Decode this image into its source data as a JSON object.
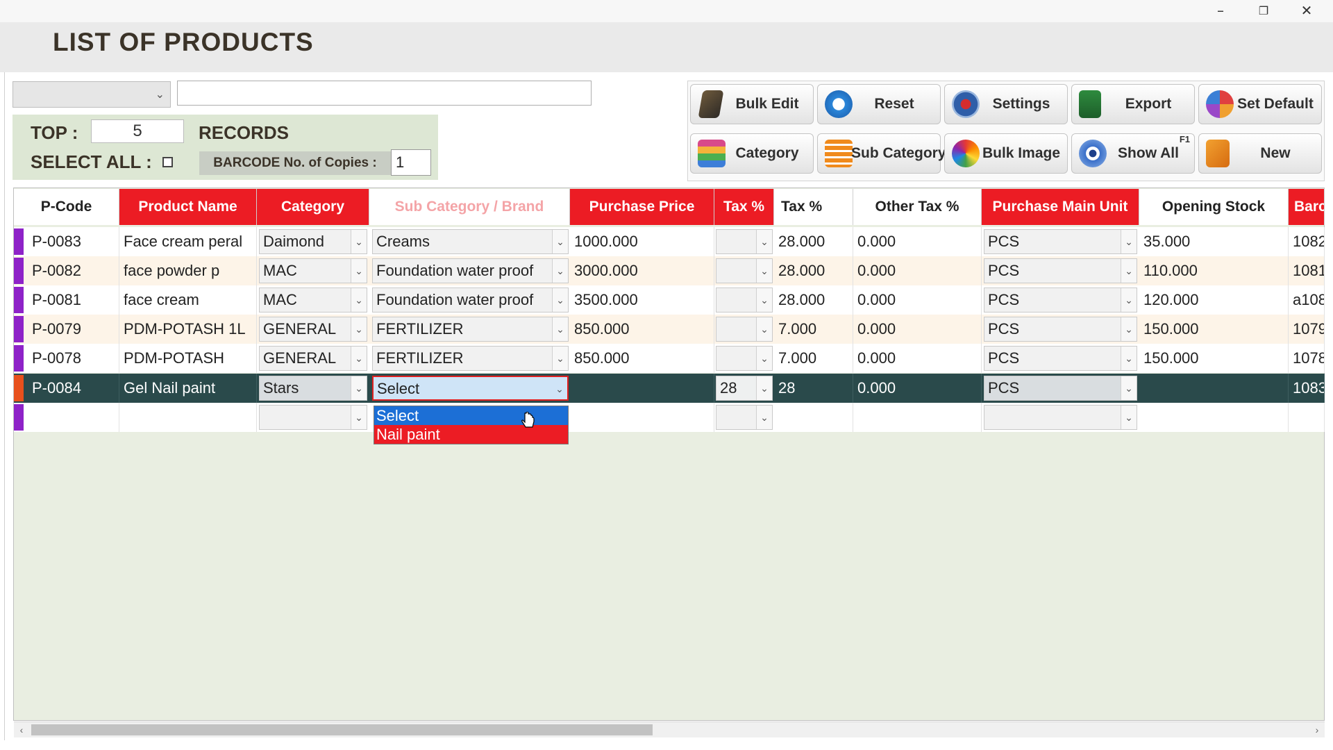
{
  "window": {
    "minimize_icon": "minimize-icon",
    "restore_icon": "restore-icon",
    "close_icon": "close-icon"
  },
  "page": {
    "title": "LIST OF PRODUCTS"
  },
  "filters": {
    "field_select_value": "",
    "search_value": "",
    "top_label": "TOP :",
    "top_value": "5",
    "records_label": "RECORDS",
    "select_all_label": "SELECT ALL :",
    "select_all_checked": false,
    "barcode_copies_label": "BARCODE No. of Copies :",
    "barcode_copies_value": "1"
  },
  "toolbar": {
    "buttons": [
      {
        "label": "Bulk Edit",
        "icon": "bulk-edit-icon"
      },
      {
        "label": "Reset",
        "icon": "reset-icon"
      },
      {
        "label": "Settings",
        "icon": "settings-icon"
      },
      {
        "label": "Export",
        "icon": "export-icon"
      },
      {
        "label": "Set Default",
        "icon": "set-default-icon"
      },
      {
        "label": "Category",
        "icon": "category-icon"
      },
      {
        "label": "Sub Category",
        "icon": "sub-category-icon"
      },
      {
        "label": "Bulk Image",
        "icon": "bulk-image-icon"
      },
      {
        "label": "Show All",
        "icon": "show-all-icon",
        "shortcut": "F1"
      },
      {
        "label": "New",
        "icon": "new-icon"
      }
    ]
  },
  "table": {
    "columns": [
      "P-Code",
      "Product Name",
      "Category",
      "Sub Category / Brand",
      "Purchase Price",
      "Tax %",
      "Tax %",
      "Other Tax %",
      "Purchase Main Unit",
      "Opening Stock",
      "Barc"
    ],
    "rows": [
      {
        "code": "P-0083",
        "name": "Face cream peral",
        "category": "Daimond",
        "sub_category": "Creams",
        "purchase_price": "1000.000",
        "tax_select": "",
        "tax": "28.000",
        "other_tax": "0.000",
        "unit": "PCS",
        "opening_stock": "35.000",
        "barcode": "1082"
      },
      {
        "code": "P-0082",
        "name": "face powder p",
        "category": "MAC",
        "sub_category": "Foundation water proof",
        "purchase_price": "3000.000",
        "tax_select": "",
        "tax": "28.000",
        "other_tax": "0.000",
        "unit": "PCS",
        "opening_stock": "110.000",
        "barcode": "1081"
      },
      {
        "code": "P-0081",
        "name": "face cream",
        "category": "MAC",
        "sub_category": "Foundation water proof",
        "purchase_price": "3500.000",
        "tax_select": "",
        "tax": "28.000",
        "other_tax": "0.000",
        "unit": "PCS",
        "opening_stock": "120.000",
        "barcode": "a108"
      },
      {
        "code": "P-0079",
        "name": "PDM-POTASH 1L",
        "category": "GENERAL",
        "sub_category": "FERTILIZER",
        "purchase_price": "850.000",
        "tax_select": "",
        "tax": "7.000",
        "other_tax": "0.000",
        "unit": "PCS",
        "opening_stock": "150.000",
        "barcode": "1079"
      },
      {
        "code": "P-0078",
        "name": "PDM-POTASH",
        "category": "GENERAL",
        "sub_category": "FERTILIZER",
        "purchase_price": "850.000",
        "tax_select": "",
        "tax": "7.000",
        "other_tax": "0.000",
        "unit": "PCS",
        "opening_stock": "150.000",
        "barcode": "1078"
      },
      {
        "code": "P-0084",
        "name": "Gel Nail paint",
        "category": "Stars",
        "sub_category": "Select",
        "purchase_price": "",
        "tax_select": "28",
        "tax": "28",
        "other_tax": "0.000",
        "unit": "PCS",
        "opening_stock": "",
        "barcode": "1083"
      },
      {
        "code": "",
        "name": "",
        "category": "",
        "sub_category": "",
        "purchase_price": "",
        "tax_select": "",
        "tax": "",
        "other_tax": "",
        "unit": "",
        "opening_stock": "",
        "barcode": ""
      }
    ],
    "selected_row": 5,
    "dropdown_options": [
      "Select",
      "Nail paint"
    ]
  },
  "colors": {
    "header_red": "#ec1c24",
    "selected_row": "#2a4a4b",
    "row_indicator": "#8e22c8",
    "selected_indicator": "#e8501c",
    "option_highlight": "#1c6fd6"
  }
}
